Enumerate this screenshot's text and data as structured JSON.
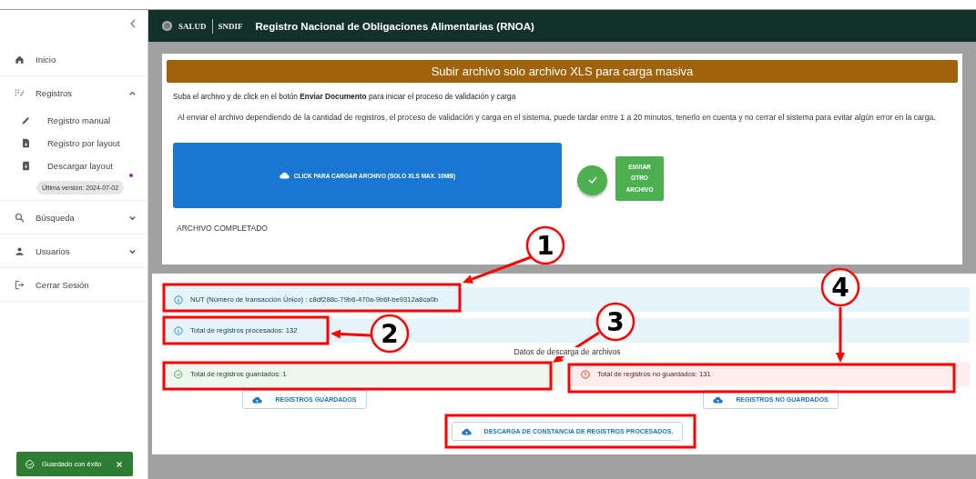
{
  "sidebar": {
    "items": [
      {
        "kind": "link",
        "label": "Inicio"
      },
      {
        "kind": "group",
        "label": "Registros",
        "expanded": true,
        "children": [
          {
            "label": "Registro manual"
          },
          {
            "label": "Registro por layout"
          },
          {
            "label": "Descargar layout",
            "badge": "Última versión: 2024-07-02"
          }
        ]
      },
      {
        "kind": "group",
        "label": "Búsqueda",
        "expanded": false
      },
      {
        "kind": "group",
        "label": "Usuarios",
        "expanded": false
      },
      {
        "kind": "link",
        "label": "Cerrar Sesión"
      }
    ]
  },
  "header": {
    "logo_1": "SALUD",
    "logo_2": "SNDIF",
    "title": "Registro Nacional de Obligaciones Alimentarias (RNOA)"
  },
  "upload": {
    "banner": "Subir archivo solo archivo XLS para carga masiva",
    "instruction": "Suba el archivo y de click en el botón **Enviar Documento** para iniciar el proceso de validación y carga",
    "note": "Al enviar el archivo dependiendo de la cantidad de registros, el proceso de validación y carga en el sistema, puede tardar entre 1 a 20 minutos, tenerlo en cuenta y no cerrar el sistema para evitar algún error en la carga.",
    "upload_button": "CLICK PARA CARGAR ARCHIVO (SOLO XLS MAX. 10MB)",
    "send_button": "ENVIAR OTRO ARCHIVO",
    "status": "ARCHIVO COMPLETADO"
  },
  "results": {
    "alerts": [
      {
        "kind": "info",
        "text": "NUT (Número de transacción Único) : c8df288c-79b6-470a-9b6f-be9312a8ca0b"
      },
      {
        "kind": "info",
        "text": "Total de registros procesados: 132"
      }
    ],
    "section_title": "Datos de descarga de archivos",
    "columns": [
      {
        "alert": {
          "kind": "success",
          "text": "Total de registros guardados: 1"
        },
        "button": "REGISTROS GUARDADOS"
      },
      {
        "alert": {
          "kind": "error",
          "text": "Total de registros no guardados: 131"
        },
        "button": "REGISTROS NO GUARDADOS"
      }
    ],
    "download_button": "DESCARGA DE CONSTANCIA DE REGISTROS PROCESADOS."
  },
  "toast": {
    "text": "Guardado con éxito"
  },
  "annotations": [
    {
      "kind": "callout",
      "number": "1"
    },
    {
      "kind": "callout",
      "number": "2"
    },
    {
      "kind": "callout",
      "number": "3"
    },
    {
      "kind": "callout",
      "number": "4"
    },
    {
      "kind": "box"
    }
  ]
}
